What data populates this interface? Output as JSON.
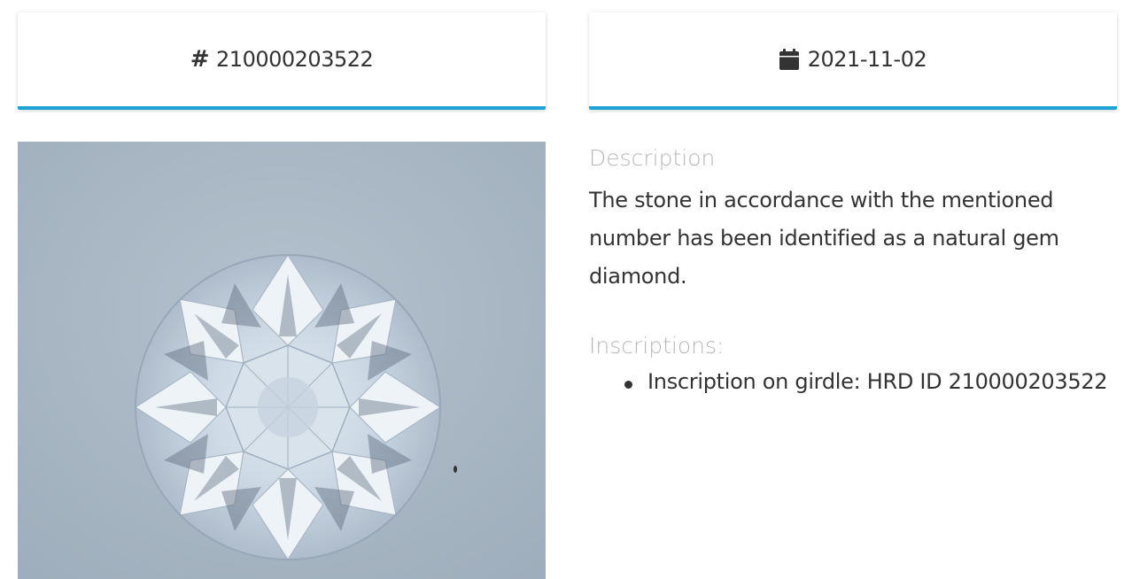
{
  "header": {
    "certificate_number": "210000203522",
    "hash_symbol": "#",
    "date": "2021-11-02",
    "date_icon": "calendar-icon",
    "accent_color": "#1fa2d6"
  },
  "image": {
    "subject": "round brilliant diamond",
    "background_color": "#a8b6c3"
  },
  "details": {
    "description_label": "Description",
    "description_text": "The stone in accordance with the mentioned number has been identified as a natural gem diamond.",
    "inscriptions_label": "Inscriptions:",
    "inscriptions": [
      "Inscription on girdle: HRD ID 210000203522"
    ]
  }
}
